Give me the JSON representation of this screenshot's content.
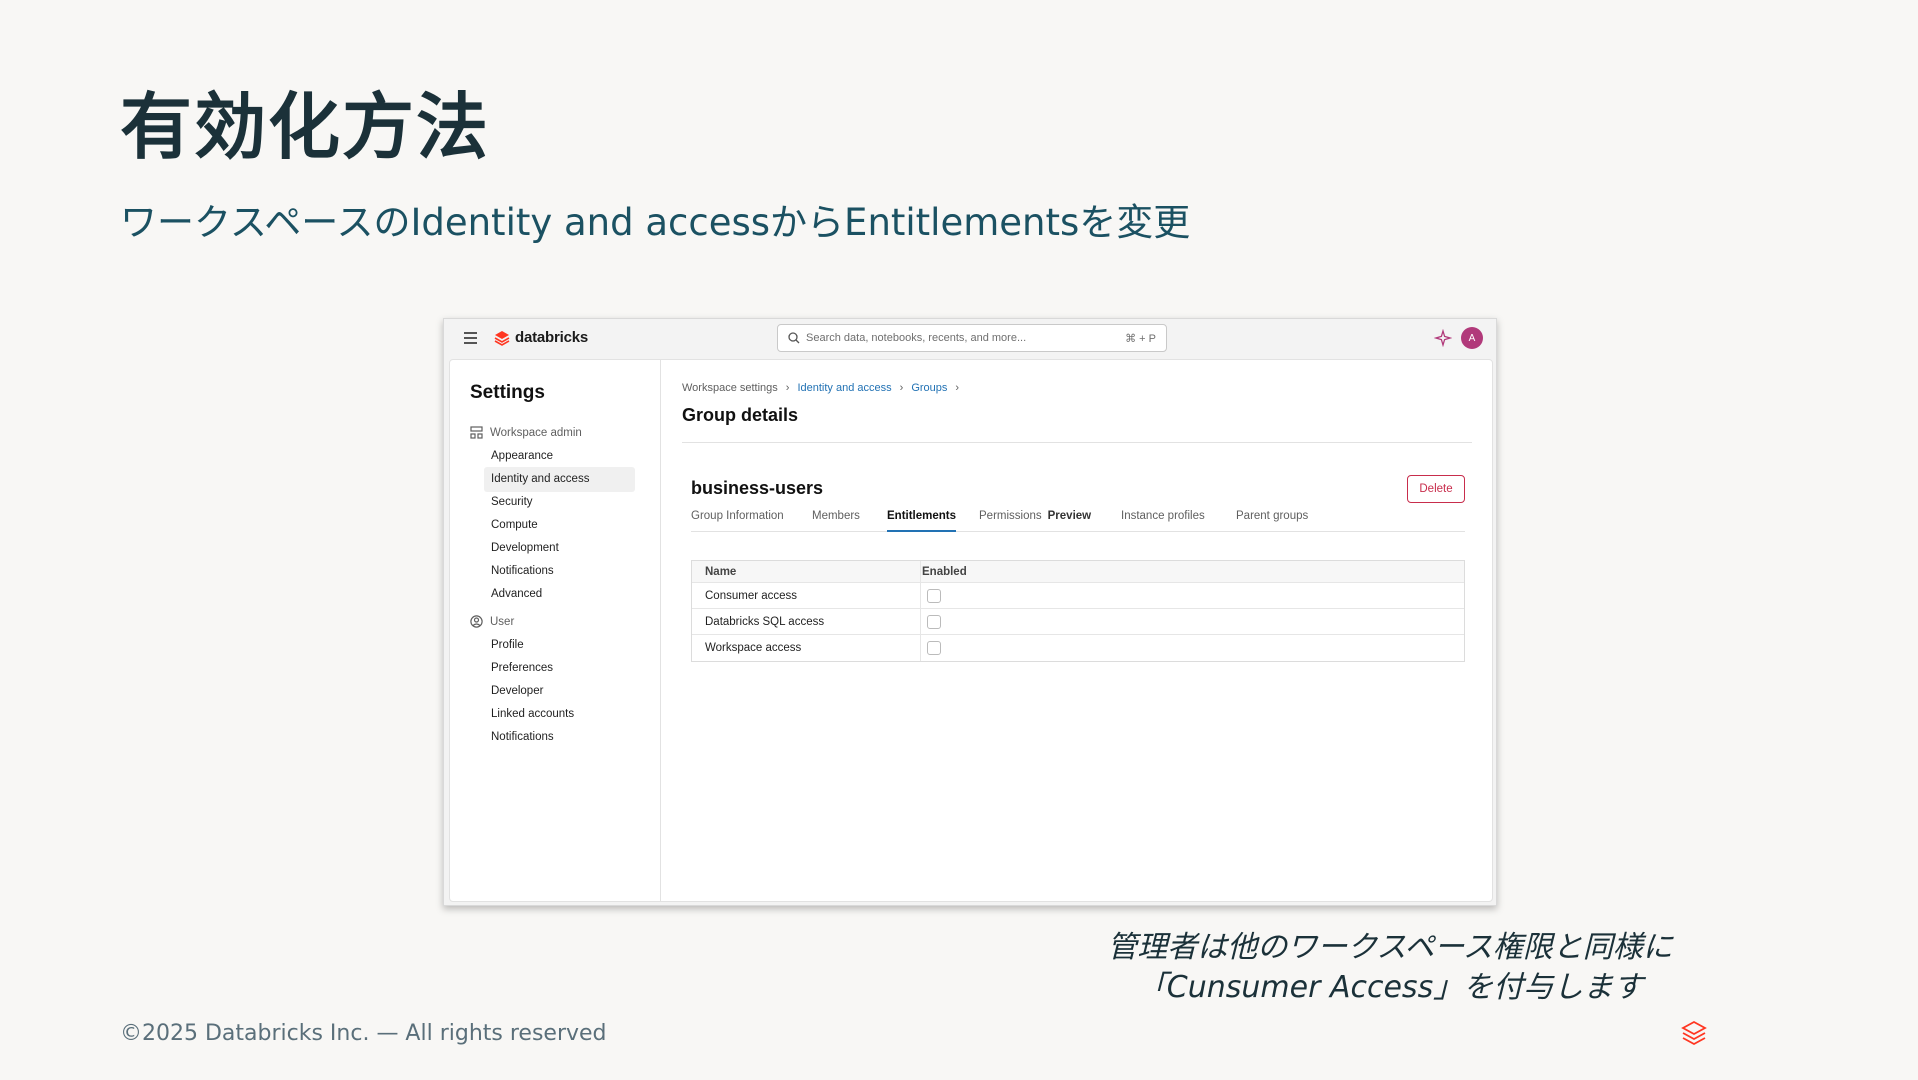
{
  "slide": {
    "title": "有効化方法",
    "subtitle": "ワークスペースのIdentity and accessからEntitlementsを変更",
    "note_line1": "管理者は他のワークスペース権限と同様に",
    "note_line2": "「Cunsumer Access」を付与します",
    "footer": "©2025 Databricks Inc. — All rights reserved"
  },
  "app": {
    "brand": "databricks",
    "search_placeholder": "Search data, notebooks, recents, and more...",
    "search_shortcut": "⌘ + P",
    "avatar_initial": "A",
    "accent_color": "#2272b4",
    "brand_color": "#ff3621"
  },
  "sidebar": {
    "title": "Settings",
    "workspace_admin_label": "Workspace admin",
    "workspace_admin_items": [
      "Appearance",
      "Identity and access",
      "Security",
      "Compute",
      "Development",
      "Notifications",
      "Advanced"
    ],
    "active_item": "Identity and access",
    "user_label": "User",
    "user_items": [
      "Profile",
      "Preferences",
      "Developer",
      "Linked accounts",
      "Notifications"
    ]
  },
  "main": {
    "breadcrumb": [
      "Workspace settings",
      "Identity and access",
      "Groups"
    ],
    "page_title": "Group details",
    "group_name": "business-users",
    "delete_label": "Delete",
    "tabs": [
      "Group Information",
      "Members",
      "Entitlements",
      "Permissions",
      "Instance profiles",
      "Parent groups"
    ],
    "preview_badge": "Preview",
    "active_tab": "Entitlements",
    "table": {
      "headers": [
        "Name",
        "Enabled"
      ],
      "rows": [
        {
          "name": "Consumer access",
          "enabled": true
        },
        {
          "name": "Databricks SQL access",
          "enabled": false
        },
        {
          "name": "Workspace access",
          "enabled": false
        }
      ]
    }
  }
}
